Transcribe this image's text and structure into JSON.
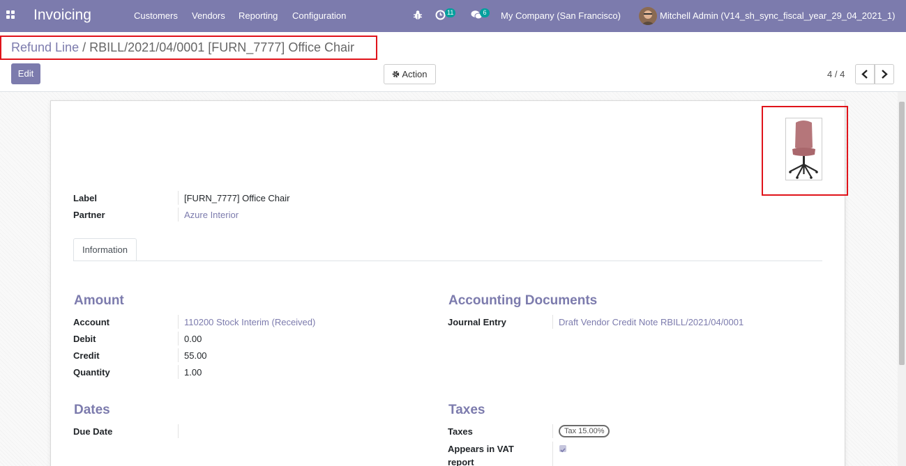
{
  "navbar": {
    "app_title": "Invoicing",
    "menu": [
      "Customers",
      "Vendors",
      "Reporting",
      "Configuration"
    ],
    "activity_count": "11",
    "message_count": "6",
    "company": "My Company (San Francisco)",
    "user": "Mitchell Admin (V14_sh_sync_fiscal_year_29_04_2021_1)",
    "color": "#7c7bad"
  },
  "breadcrumb": {
    "parent": "Refund Line",
    "separator": "/",
    "current": "RBILL/2021/04/0001 [FURN_7777] Office Chair"
  },
  "toolbar": {
    "edit_label": "Edit",
    "action_label": "Action",
    "pager": "4 / 4"
  },
  "product_image": {
    "icon": "office-chair-image"
  },
  "fields": {
    "label": {
      "label": "Label",
      "value": "[FURN_7777] Office Chair"
    },
    "partner": {
      "label": "Partner",
      "value": "Azure Interior"
    }
  },
  "tabs": [
    "Information"
  ],
  "amount": {
    "title": "Amount",
    "account": {
      "label": "Account",
      "value": "110200 Stock Interim (Received)"
    },
    "debit": {
      "label": "Debit",
      "value": "0.00"
    },
    "credit": {
      "label": "Credit",
      "value": "55.00"
    },
    "quantity": {
      "label": "Quantity",
      "value": "1.00"
    }
  },
  "accounting_documents": {
    "title": "Accounting Documents",
    "journal_entry": {
      "label": "Journal Entry",
      "value": "Draft Vendor Credit Note RBILL/2021/04/0001"
    }
  },
  "dates": {
    "title": "Dates",
    "due_date": {
      "label": "Due Date",
      "value": ""
    }
  },
  "taxes": {
    "title": "Taxes",
    "taxes": {
      "label": "Taxes",
      "value": "Tax 15.00%"
    },
    "vat": {
      "label_line1": "Appears in VAT",
      "label_line2": "report",
      "checked": true
    }
  }
}
